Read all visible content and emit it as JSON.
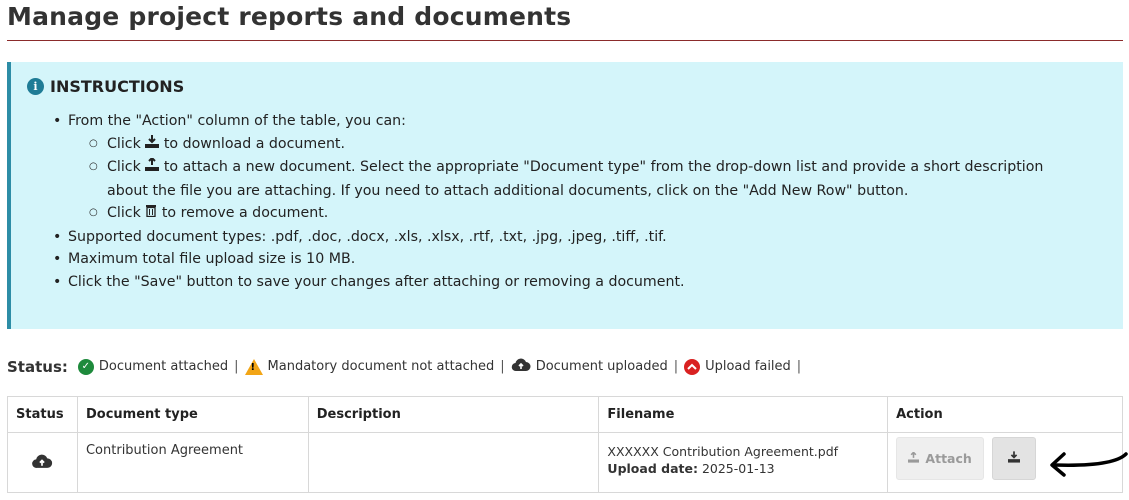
{
  "page": {
    "title": "Manage project reports and documents"
  },
  "instructions": {
    "heading": "INSTRUCTIONS",
    "intro": "From the \"Action\" column of the table, you can:",
    "download": {
      "prefix": "Click",
      "suffix": "to download a document."
    },
    "attach": {
      "prefix": "Click",
      "suffix": "to attach a new document. Select the appropriate \"Document type\" from the drop-down list and provide a short description about the file you are attaching. If you need to attach additional documents, click on the \"Add New Row\" button."
    },
    "remove": {
      "prefix": "Click",
      "suffix": "to remove a document."
    },
    "supported": "Supported document types: .pdf, .doc, .docx, .xls, .xlsx, .rtf, .txt, .jpg, .jpeg, .tiff, .tif.",
    "max_size": "Maximum total file upload size is 10 MB.",
    "save_note": "Click the \"Save\" button to save your changes after attaching or removing a document."
  },
  "status_legend": {
    "label": "Status:",
    "items": [
      {
        "text": "Document attached",
        "icon": "check-circle-icon",
        "color": "#1e8a3c"
      },
      {
        "text": "Mandatory document not attached",
        "icon": "warning-icon",
        "color": "#f2a516"
      },
      {
        "text": "Document uploaded",
        "icon": "cloud-upload-icon",
        "color": "#333333"
      },
      {
        "text": "Upload failed",
        "icon": "chevron-up-circle-icon",
        "color": "#d92121"
      }
    ],
    "separator": "|"
  },
  "table": {
    "headers": [
      "Status",
      "Document type",
      "Description",
      "Filename",
      "Action"
    ],
    "rows": [
      {
        "status_icon": "cloud-upload-icon",
        "document_type": "Contribution Agreement",
        "description": "",
        "filename": "XXXXXX Contribution Agreement.pdf",
        "upload_label": "Upload date:",
        "upload_date": "2025-01-13",
        "attach_label": "Attach"
      }
    ]
  }
}
